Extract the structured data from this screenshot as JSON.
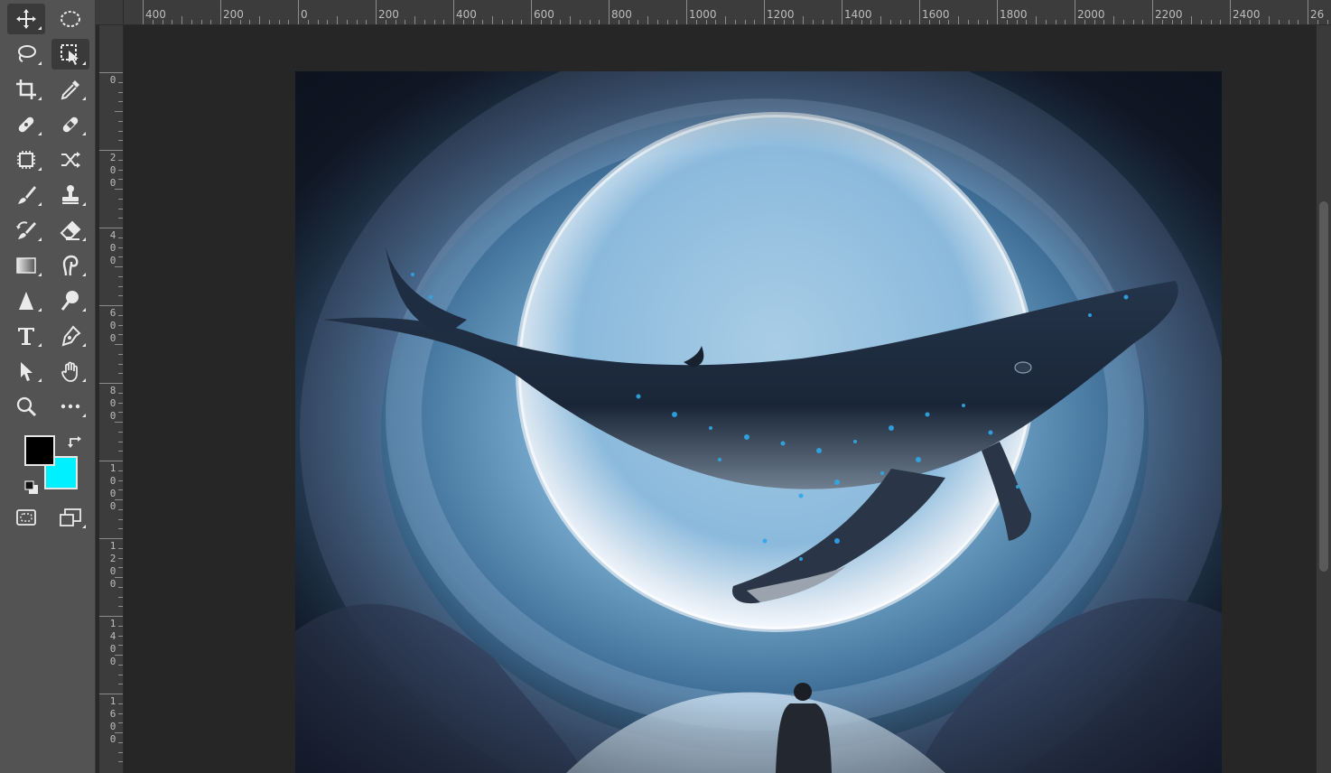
{
  "toolbar": {
    "tools": [
      {
        "name": "move-tool",
        "icon": "move-icon"
      },
      {
        "name": "elliptical-marquee-tool",
        "icon": "ellipse-marquee-icon"
      },
      {
        "name": "lasso-tool",
        "icon": "lasso-icon"
      },
      {
        "name": "object-selection-tool",
        "icon": "object-select-icon"
      },
      {
        "name": "crop-tool",
        "icon": "crop-icon"
      },
      {
        "name": "eyedropper-tool",
        "icon": "eyedropper-icon"
      },
      {
        "name": "spot-healing-tool",
        "icon": "bandage-icon"
      },
      {
        "name": "healing-brush-tool",
        "icon": "bandage-icon"
      },
      {
        "name": "content-aware-tool",
        "icon": "chip-icon"
      },
      {
        "name": "shuffle-tool",
        "icon": "shuffle-icon"
      },
      {
        "name": "brush-tool",
        "icon": "brush-icon"
      },
      {
        "name": "clone-stamp-tool",
        "icon": "stamp-icon"
      },
      {
        "name": "history-brush-tool",
        "icon": "history-brush-icon"
      },
      {
        "name": "eraser-tool",
        "icon": "eraser-icon"
      },
      {
        "name": "gradient-tool",
        "icon": "gradient-icon"
      },
      {
        "name": "smudge-tool",
        "icon": "finger-icon"
      },
      {
        "name": "blur-tool",
        "icon": "triangle-icon"
      },
      {
        "name": "dodge-tool",
        "icon": "dodge-icon"
      },
      {
        "name": "type-tool",
        "icon": "type-icon"
      },
      {
        "name": "pen-tool",
        "icon": "pen-icon"
      },
      {
        "name": "path-selection-tool",
        "icon": "arrow-icon"
      },
      {
        "name": "hand-tool",
        "icon": "hand-icon"
      },
      {
        "name": "zoom-tool",
        "icon": "zoom-icon"
      },
      {
        "name": "more-tools",
        "icon": "more-icon"
      }
    ],
    "foreground_color": "#000000",
    "background_color": "#00f0ff"
  },
  "rulers": {
    "horizontal_labels": [
      "400",
      "200",
      "0",
      "200",
      "400",
      "600",
      "800",
      "1000",
      "1200",
      "1400",
      "1600",
      "1800",
      "2000",
      "2200",
      "2400",
      "26"
    ],
    "vertical_labels": [
      "0",
      "200",
      "400",
      "600",
      "800",
      "1000",
      "1200",
      "1400",
      "1600"
    ]
  },
  "canvas": {
    "image_subject": "whale-in-sky-artwork"
  }
}
